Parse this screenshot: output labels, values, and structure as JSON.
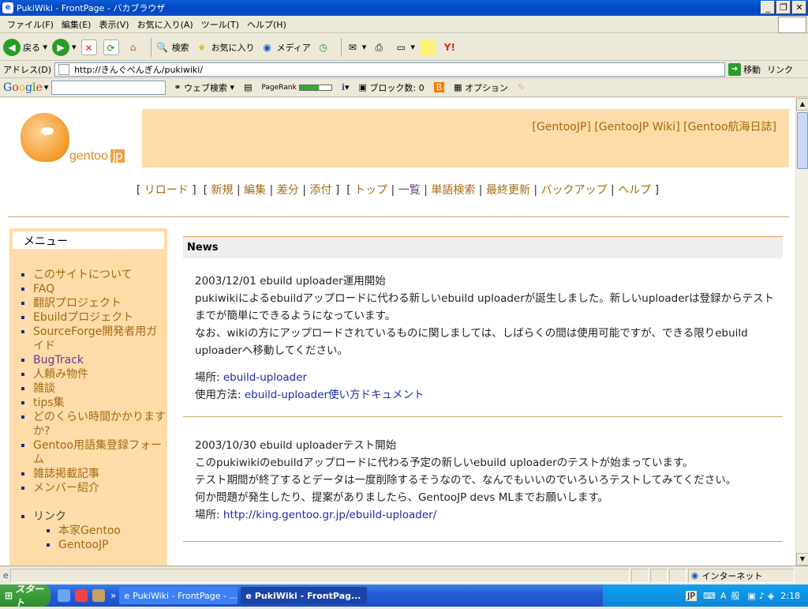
{
  "window": {
    "title": "PukiWiki - FrontPage - バカブラウザ"
  },
  "menubar": [
    "ファイル(F)",
    "編集(E)",
    "表示(V)",
    "お気に入り(A)",
    "ツール(T)",
    "ヘルプ(H)"
  ],
  "toolbar": {
    "back": "戻る",
    "search": "検索",
    "favorites": "お気に入り",
    "media": "メディア"
  },
  "address": {
    "label": "アドレス(D)",
    "url": "http://きんぐぺんぎん/pukiwiki/",
    "go": "移動",
    "links": "リンク"
  },
  "googlebar": {
    "logo": "Google",
    "web_search": "ウェブ検索",
    "pagerank": "PageRank",
    "blocked": "ブロック数: 0",
    "options": "オプション"
  },
  "site": {
    "logo_text": "gentoo",
    "logo_jp": "jp",
    "external_links": [
      "[GentooJP]",
      "[GentooJP Wiki]",
      "[Gentoo航海日誌]"
    ],
    "nav": {
      "group1": [
        "リロード"
      ],
      "group2": [
        "新規",
        "編集",
        "差分",
        "添付"
      ],
      "group3": [
        "トップ",
        "一覧",
        "単語検索",
        "最終更新",
        "バックアップ",
        "ヘルプ"
      ]
    }
  },
  "sidebar": {
    "title": "メニュー",
    "items": [
      "このサイトについて",
      "FAQ",
      "翻訳プロジェクト",
      "Ebuildプロジェクト",
      "SourceForge開発者用ガイド",
      "BugTrack",
      "人頼み物件",
      "雑談",
      "tips集",
      "どのくらい時間かかりますか?",
      "Gentoo用語集登録フォーム",
      "雑誌掲載記事",
      "メンバー紹介"
    ],
    "links_heading": "リンク",
    "links": [
      "本家Gentoo",
      "GentooJP"
    ]
  },
  "news": {
    "heading": "News",
    "item1": {
      "title": "2003/12/01 ebuild uploader運用開始",
      "line1": "pukiwikiによるebuildアップロードに代わる新しいebuild uploaderが誕生しました。新しいuploaderは登録からテストまでが簡単にできるようになっています。",
      "line2": "なお、wikiの方にアップロードされているものに関しましては、しばらくの間は使用可能ですが、できる限りebuild uploaderへ移動してください。",
      "place_label": "場所: ",
      "place_link": "ebuild-uploader",
      "usage_label": "使用方法: ",
      "usage_link": "ebuild-uploader使い方ドキュメント"
    },
    "item2": {
      "title": "2003/10/30 ebuild uploaderテスト開始",
      "line1": "このpukiwikiのebuildアップロードに代わる予定の新しいebuild uploaderのテストが始まっています。",
      "line2": "テスト期間が終了するとデータは一度削除するそうなので、なんでもいいのでいろいろテストしてみてください。",
      "line3": "何か問題が発生したり、提案がありましたら、GentooJP devs MLまでお願いします。",
      "place_label": "場所: ",
      "place_link": "http://king.gentoo.gr.jp/ebuild-uploader/"
    }
  },
  "statusbar": {
    "zone": "インターネット"
  },
  "taskbar": {
    "start": "スタート",
    "tasks": [
      "PukiWiki - FrontPage - ...",
      "PukiWiki - FrontPag..."
    ],
    "ime": "JP",
    "ime_mode": "般",
    "clock": "2:18"
  }
}
